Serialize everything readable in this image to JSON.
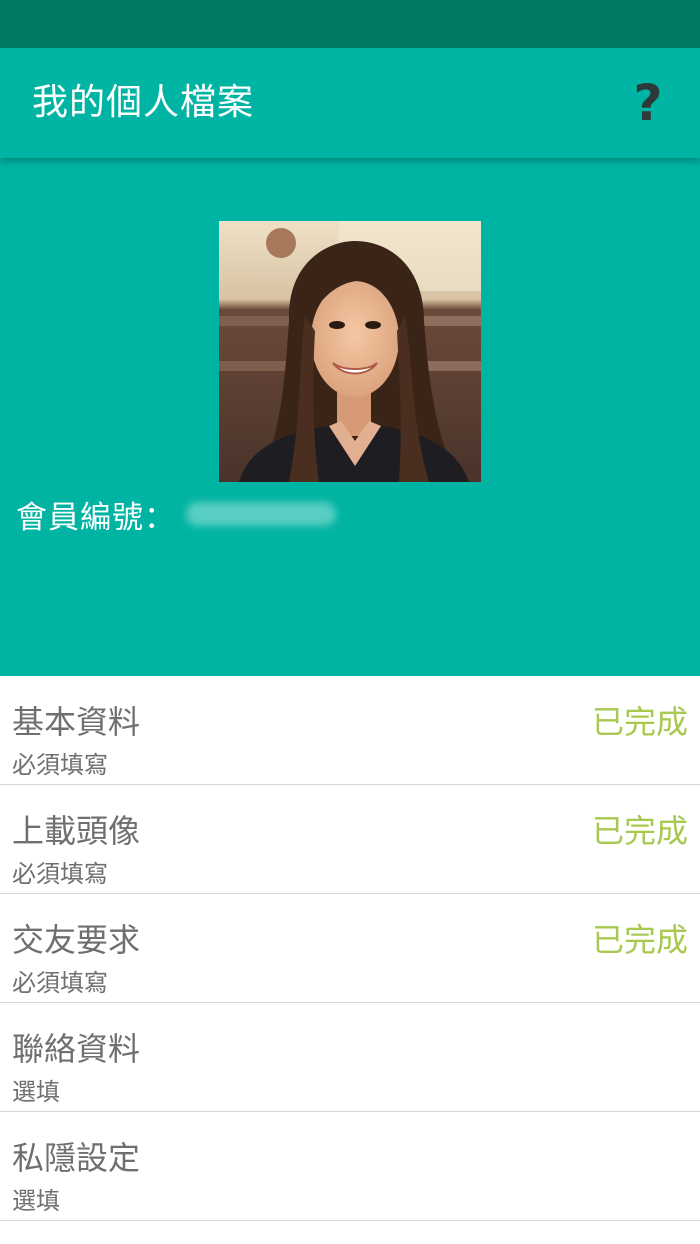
{
  "app_bar": {
    "title": "我的個人檔案",
    "help_label": "?"
  },
  "profile": {
    "member_id_label": "會員編號："
  },
  "menu": {
    "items": [
      {
        "title": "基本資料",
        "subtitle": "必須填寫",
        "status": "已完成"
      },
      {
        "title": "上載頭像",
        "subtitle": "必須填寫",
        "status": "已完成"
      },
      {
        "title": "交友要求",
        "subtitle": "必須填寫",
        "status": "已完成"
      },
      {
        "title": "聯絡資料",
        "subtitle": "選填",
        "status": ""
      },
      {
        "title": "私隱設定",
        "subtitle": "選填",
        "status": ""
      }
    ]
  },
  "colors": {
    "status_bar": "#007a63",
    "primary": "#00b4a3",
    "completed": "#a7c94f",
    "text_gray": "#6f6f6f"
  },
  "icons": {
    "help": "question-mark-icon"
  }
}
